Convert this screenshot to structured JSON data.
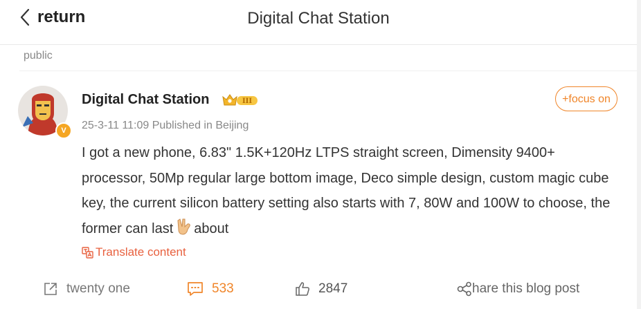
{
  "header": {
    "back_label": "return",
    "title": "Digital Chat Station"
  },
  "scope": "public",
  "post": {
    "author": "Digital Chat Station",
    "verified_badge": "V",
    "level_badge": "III",
    "follow_label": "+focus on",
    "meta": "25-3-11 11:09 Published in Beijing",
    "text_before_emoji": "I got a new phone, 6.83\" 1.5K+120Hz LTPS straight screen, Dimensity 9400+ processor, 50Mp regular large bottom image, Deco simple design, custom magic cube key, the current silicon battery setting also starts with 7, 80W and 100W to choose, the former can last",
    "text_after_emoji": "about",
    "emoji": "victory-hand",
    "translate_label": "Translate content"
  },
  "actions": {
    "share_label": "twenty one",
    "comment_count": "533",
    "like_count": "2847",
    "repost_label": "hare this blog post"
  },
  "colors": {
    "accent": "#f08529",
    "translate": "#e8613f",
    "meta": "#888888"
  }
}
